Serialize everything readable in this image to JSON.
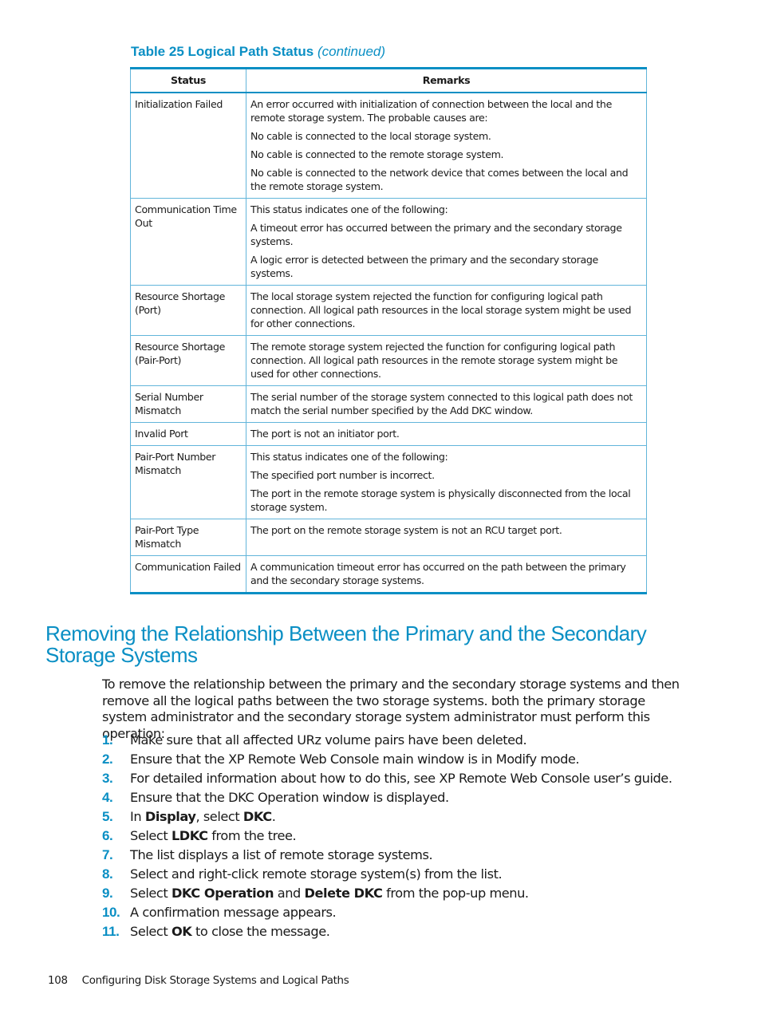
{
  "table": {
    "caption_label": "Table 25 Logical Path Status",
    "caption_suffix": "(continued)",
    "headers": [
      "Status",
      "Remarks"
    ],
    "rows": [
      {
        "status": "Initialization Failed",
        "remarks": [
          "An error occurred with initialization of connection between the local and the remote storage system. The probable causes are:",
          "No cable is connected to the local storage system.",
          "No cable is connected to the remote storage system.",
          "No cable is connected to the network device that comes between the local and the remote storage system."
        ]
      },
      {
        "status": "Communication Time Out",
        "remarks": [
          "This status indicates one of the following:",
          "A timeout error has occurred between the primary and the secondary storage systems.",
          "A logic error is detected between the primary and the secondary storage systems."
        ]
      },
      {
        "status": "Resource Shortage (Port)",
        "remarks": [
          "The local storage system rejected the function for configuring logical path connection. All logical path resources in the local storage system might be used for other connections."
        ]
      },
      {
        "status": "Resource Shortage (Pair-Port)",
        "remarks": [
          "The remote storage system rejected the function for configuring logical path connection. All logical path resources in the remote storage system might be used for other connections."
        ]
      },
      {
        "status": "Serial Number Mismatch",
        "remarks": [
          "The serial number of the storage system connected to this logical path does not match the serial number specified by the Add DKC window."
        ]
      },
      {
        "status": "Invalid Port",
        "remarks": [
          "The port is not an initiator port."
        ]
      },
      {
        "status": "Pair-Port Number Mismatch",
        "remarks": [
          "This status indicates one of the following:",
          "The specified port number is incorrect.",
          "The port in the remote storage system is physically disconnected from the local storage system."
        ]
      },
      {
        "status": "Pair-Port Type Mismatch",
        "remarks": [
          "The port on the remote storage system is not an RCU target port."
        ]
      },
      {
        "status": "Communication Failed",
        "remarks": [
          "A communication timeout error has occurred on the path between the primary and the secondary storage systems."
        ]
      }
    ]
  },
  "section": {
    "heading": "Removing the Relationship Between the Primary and the Secondary Storage Systems",
    "intro": "To remove the relationship between the primary and the secondary storage systems and then remove all the logical paths between the two storage systems. both the primary storage system administrator and the secondary storage system administrator must perform this operation:",
    "steps": [
      {
        "num": "1.",
        "parts": [
          {
            "t": "Make sure that all affected URz volume pairs have been deleted."
          }
        ]
      },
      {
        "num": "2.",
        "parts": [
          {
            "t": "Ensure that the XP Remote Web Console main window is in Modify mode."
          }
        ]
      },
      {
        "num": "3.",
        "parts": [
          {
            "t": "For detailed information about how to do this, see XP Remote Web Console user’s guide."
          }
        ]
      },
      {
        "num": "4.",
        "parts": [
          {
            "t": "Ensure that the DKC Operation window is displayed."
          }
        ]
      },
      {
        "num": "5.",
        "parts": [
          {
            "t": "In "
          },
          {
            "t": "Display",
            "b": true
          },
          {
            "t": ", select "
          },
          {
            "t": "DKC",
            "b": true
          },
          {
            "t": "."
          }
        ]
      },
      {
        "num": "6.",
        "parts": [
          {
            "t": "Select "
          },
          {
            "t": "LDKC",
            "b": true
          },
          {
            "t": " from the tree."
          }
        ]
      },
      {
        "num": "7.",
        "parts": [
          {
            "t": "The list displays a list of remote storage systems."
          }
        ]
      },
      {
        "num": "8.",
        "parts": [
          {
            "t": "Select and right-click remote storage system(s) from the list."
          }
        ]
      },
      {
        "num": "9.",
        "parts": [
          {
            "t": "Select "
          },
          {
            "t": "DKC Operation",
            "b": true
          },
          {
            "t": " and "
          },
          {
            "t": "Delete DKC",
            "b": true
          },
          {
            "t": " from the pop-up menu."
          }
        ]
      },
      {
        "num": "10.",
        "parts": [
          {
            "t": "A confirmation message appears."
          }
        ]
      },
      {
        "num": "11.",
        "parts": [
          {
            "t": "Select "
          },
          {
            "t": "OK",
            "b": true
          },
          {
            "t": " to close the message."
          }
        ]
      }
    ]
  },
  "footer": {
    "page_number": "108",
    "chapter_title": "Configuring Disk Storage Systems and Logical Paths"
  },
  "colors": {
    "accent": "#0a8fc4",
    "table_rule": "#62b5da",
    "text": "#1a1a1a"
  }
}
